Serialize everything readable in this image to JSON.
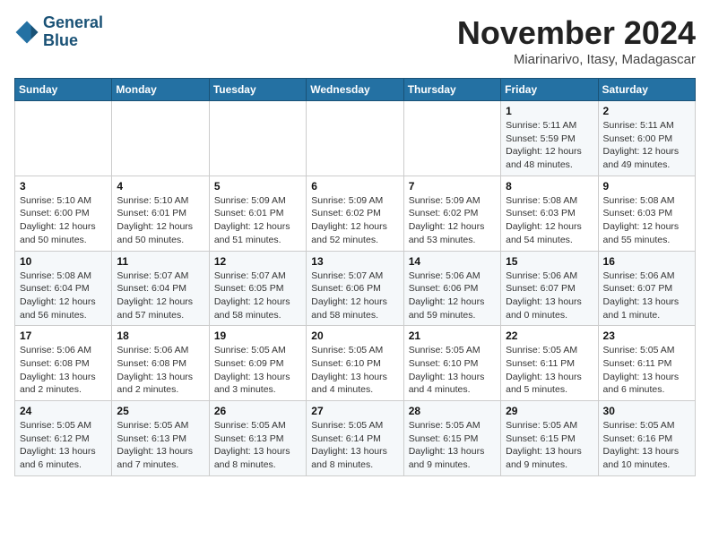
{
  "logo": {
    "line1": "General",
    "line2": "Blue"
  },
  "header": {
    "title": "November 2024",
    "location": "Miarinarivo, Itasy, Madagascar"
  },
  "weekdays": [
    "Sunday",
    "Monday",
    "Tuesday",
    "Wednesday",
    "Thursday",
    "Friday",
    "Saturday"
  ],
  "weeks": [
    [
      {
        "day": "",
        "info": ""
      },
      {
        "day": "",
        "info": ""
      },
      {
        "day": "",
        "info": ""
      },
      {
        "day": "",
        "info": ""
      },
      {
        "day": "",
        "info": ""
      },
      {
        "day": "1",
        "info": "Sunrise: 5:11 AM\nSunset: 5:59 PM\nDaylight: 12 hours\nand 48 minutes."
      },
      {
        "day": "2",
        "info": "Sunrise: 5:11 AM\nSunset: 6:00 PM\nDaylight: 12 hours\nand 49 minutes."
      }
    ],
    [
      {
        "day": "3",
        "info": "Sunrise: 5:10 AM\nSunset: 6:00 PM\nDaylight: 12 hours\nand 50 minutes."
      },
      {
        "day": "4",
        "info": "Sunrise: 5:10 AM\nSunset: 6:01 PM\nDaylight: 12 hours\nand 50 minutes."
      },
      {
        "day": "5",
        "info": "Sunrise: 5:09 AM\nSunset: 6:01 PM\nDaylight: 12 hours\nand 51 minutes."
      },
      {
        "day": "6",
        "info": "Sunrise: 5:09 AM\nSunset: 6:02 PM\nDaylight: 12 hours\nand 52 minutes."
      },
      {
        "day": "7",
        "info": "Sunrise: 5:09 AM\nSunset: 6:02 PM\nDaylight: 12 hours\nand 53 minutes."
      },
      {
        "day": "8",
        "info": "Sunrise: 5:08 AM\nSunset: 6:03 PM\nDaylight: 12 hours\nand 54 minutes."
      },
      {
        "day": "9",
        "info": "Sunrise: 5:08 AM\nSunset: 6:03 PM\nDaylight: 12 hours\nand 55 minutes."
      }
    ],
    [
      {
        "day": "10",
        "info": "Sunrise: 5:08 AM\nSunset: 6:04 PM\nDaylight: 12 hours\nand 56 minutes."
      },
      {
        "day": "11",
        "info": "Sunrise: 5:07 AM\nSunset: 6:04 PM\nDaylight: 12 hours\nand 57 minutes."
      },
      {
        "day": "12",
        "info": "Sunrise: 5:07 AM\nSunset: 6:05 PM\nDaylight: 12 hours\nand 58 minutes."
      },
      {
        "day": "13",
        "info": "Sunrise: 5:07 AM\nSunset: 6:06 PM\nDaylight: 12 hours\nand 58 minutes."
      },
      {
        "day": "14",
        "info": "Sunrise: 5:06 AM\nSunset: 6:06 PM\nDaylight: 12 hours\nand 59 minutes."
      },
      {
        "day": "15",
        "info": "Sunrise: 5:06 AM\nSunset: 6:07 PM\nDaylight: 13 hours\nand 0 minutes."
      },
      {
        "day": "16",
        "info": "Sunrise: 5:06 AM\nSunset: 6:07 PM\nDaylight: 13 hours\nand 1 minute."
      }
    ],
    [
      {
        "day": "17",
        "info": "Sunrise: 5:06 AM\nSunset: 6:08 PM\nDaylight: 13 hours\nand 2 minutes."
      },
      {
        "day": "18",
        "info": "Sunrise: 5:06 AM\nSunset: 6:08 PM\nDaylight: 13 hours\nand 2 minutes."
      },
      {
        "day": "19",
        "info": "Sunrise: 5:05 AM\nSunset: 6:09 PM\nDaylight: 13 hours\nand 3 minutes."
      },
      {
        "day": "20",
        "info": "Sunrise: 5:05 AM\nSunset: 6:10 PM\nDaylight: 13 hours\nand 4 minutes."
      },
      {
        "day": "21",
        "info": "Sunrise: 5:05 AM\nSunset: 6:10 PM\nDaylight: 13 hours\nand 4 minutes."
      },
      {
        "day": "22",
        "info": "Sunrise: 5:05 AM\nSunset: 6:11 PM\nDaylight: 13 hours\nand 5 minutes."
      },
      {
        "day": "23",
        "info": "Sunrise: 5:05 AM\nSunset: 6:11 PM\nDaylight: 13 hours\nand 6 minutes."
      }
    ],
    [
      {
        "day": "24",
        "info": "Sunrise: 5:05 AM\nSunset: 6:12 PM\nDaylight: 13 hours\nand 6 minutes."
      },
      {
        "day": "25",
        "info": "Sunrise: 5:05 AM\nSunset: 6:13 PM\nDaylight: 13 hours\nand 7 minutes."
      },
      {
        "day": "26",
        "info": "Sunrise: 5:05 AM\nSunset: 6:13 PM\nDaylight: 13 hours\nand 8 minutes."
      },
      {
        "day": "27",
        "info": "Sunrise: 5:05 AM\nSunset: 6:14 PM\nDaylight: 13 hours\nand 8 minutes."
      },
      {
        "day": "28",
        "info": "Sunrise: 5:05 AM\nSunset: 6:15 PM\nDaylight: 13 hours\nand 9 minutes."
      },
      {
        "day": "29",
        "info": "Sunrise: 5:05 AM\nSunset: 6:15 PM\nDaylight: 13 hours\nand 9 minutes."
      },
      {
        "day": "30",
        "info": "Sunrise: 5:05 AM\nSunset: 6:16 PM\nDaylight: 13 hours\nand 10 minutes."
      }
    ]
  ]
}
